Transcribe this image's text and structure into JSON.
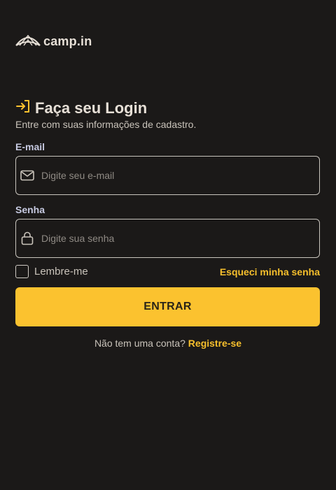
{
  "brand": {
    "name": "camp.in",
    "logo_icon": "tent-icon",
    "accent_color": "#fbc22f"
  },
  "login": {
    "title_icon": "sign-in-arrow-icon",
    "title": "Faça seu Login",
    "subtitle": "Entre com suas informações de cadastro."
  },
  "fields": {
    "email": {
      "label": "E-mail",
      "icon": "mail-icon",
      "value": "",
      "placeholder": "Digite seu e-mail"
    },
    "password": {
      "label": "Senha",
      "icon": "lock-icon",
      "value": "",
      "placeholder": "Digite sua senha"
    }
  },
  "options": {
    "remember_label": "Lembre-me",
    "remember_checked": false,
    "forgot_label": "Esqueci minha senha"
  },
  "actions": {
    "submit_label": "ENTRAR"
  },
  "register": {
    "prompt": "Não tem uma conta?",
    "link_label": "Registre-se"
  }
}
